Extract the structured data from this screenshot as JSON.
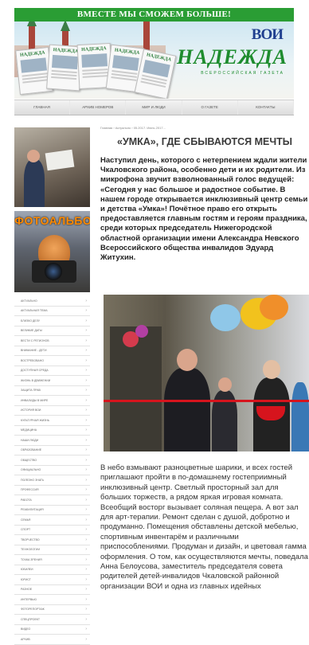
{
  "header": {
    "slogan": "ВМЕСТЕ МЫ СМОЖЕМ БОЛЬШЕ!",
    "org_logo": "ВОИ",
    "newspaper_title": "НАДЕЖДА",
    "newspaper_subtitle": "ВСЕРОССИЙСКАЯ ГАЗЕТА",
    "paper_masthead": "НАДЕЖДА"
  },
  "nav": {
    "items": [
      "ГЛАВНАЯ",
      "АРХИВ НОМЕРОВ",
      "МИР И ЛЮДИ",
      "О ГАЗЕТЕ",
      "КОНТАКТЫ"
    ]
  },
  "sidebar": {
    "album_label": "ФОТОАЛЬБОМ",
    "menu_items": [
      "АКТУАЛЬНО",
      "АКТУАЛЬНАЯ ТЕМА",
      "БЛИЗКО ДЕЛУ",
      "ВЕЛИКИЕ ДАТЫ",
      "ВЕСТИ С РЕГИОНОВ",
      "ВНИМАНИЕ - ДЕТИ",
      "ВОСТРЕБОВАНО",
      "ДОСТУПНАЯ СРЕДА",
      "ЖИЗНЬ В ДВИЖЕНИИ",
      "ЗАЩИТА ПРАВ",
      "ИНВАЛИДЫ В МИРЕ",
      "ИСТОРИЯ ВОИ",
      "КУЛЬТУРНАЯ ЖИЗНЬ",
      "МЕДИЦИНА",
      "НАШИ ЛЮДИ",
      "ОБРАЗОВАНИЕ",
      "ОБЩЕСТВО",
      "ОФИЦИАЛЬНО",
      "ПОЛЕЗНО ЗНАТЬ",
      "ПРОФЕССИЯ",
      "РАБОТА",
      "РЕАБИЛИТАЦИЯ",
      "СЕМЬЯ",
      "СПОРТ",
      "ТВОРЧЕСТВО",
      "ТЕХНОЛОГИИ",
      "ТОЧКА ЗРЕНИЯ",
      "ЮБИЛЕИ",
      "ЮРИСТ",
      "РАЗНОЕ",
      "ИНТЕРВЬЮ",
      "ФОТОРЕПОРТАЖ",
      "СПЕЦПРОЕКТ",
      "ВИДЕО",
      "АРХИВ"
    ]
  },
  "article": {
    "breadcrumb": "Главная › Актуально › 05.2017. Июнь 2017...",
    "title": "«УМКА», ГДЕ СБЫВАЮТСЯ МЕЧТЫ",
    "lead": "Наступил день, которого с нетерпением ждали жители Чкаловского района, особенно дети и их родители. Из микрофона звучит взволнованный голос ведущей: «Сегодня у нас большое и радостное событие. В нашем городе открывается инклюзивный центр семьи и детства «Умка»! Почётное право его открыть предоставляется главным гостям и героям праздника, среди которых председатель Нижегородской областной организации имени Александра Невского Всероссийского общества инвалидов Эдуард Житухин.",
    "body": "В небо взмывают разноцветные шарики, и всех гостей приглашают пройти в по-домашнему гостеприимный инклюзивный центр. Светлый просторный зал для больших торжеств, а рядом яркая игровая комната. Всеобщий восторг вызывает соляная пещера. А вот зал для арт-терапии. Ремонт сделан с душой, добротно и продуманно. Помещения обставлены детской мебелью, спортивным инвентарём и различными приспособлениями. Продуман и дизайн, и цветовая гамма оформления. О том, как осуществляются мечты, поведала Анна Белоусова, заместитель председателя совета родителей детей-инвалидов Чкаловской районной организации ВОИ и одна из главных идейных"
  },
  "colors": {
    "brand_green": "#2a9d34",
    "ribbon_red": "#d6141d"
  }
}
